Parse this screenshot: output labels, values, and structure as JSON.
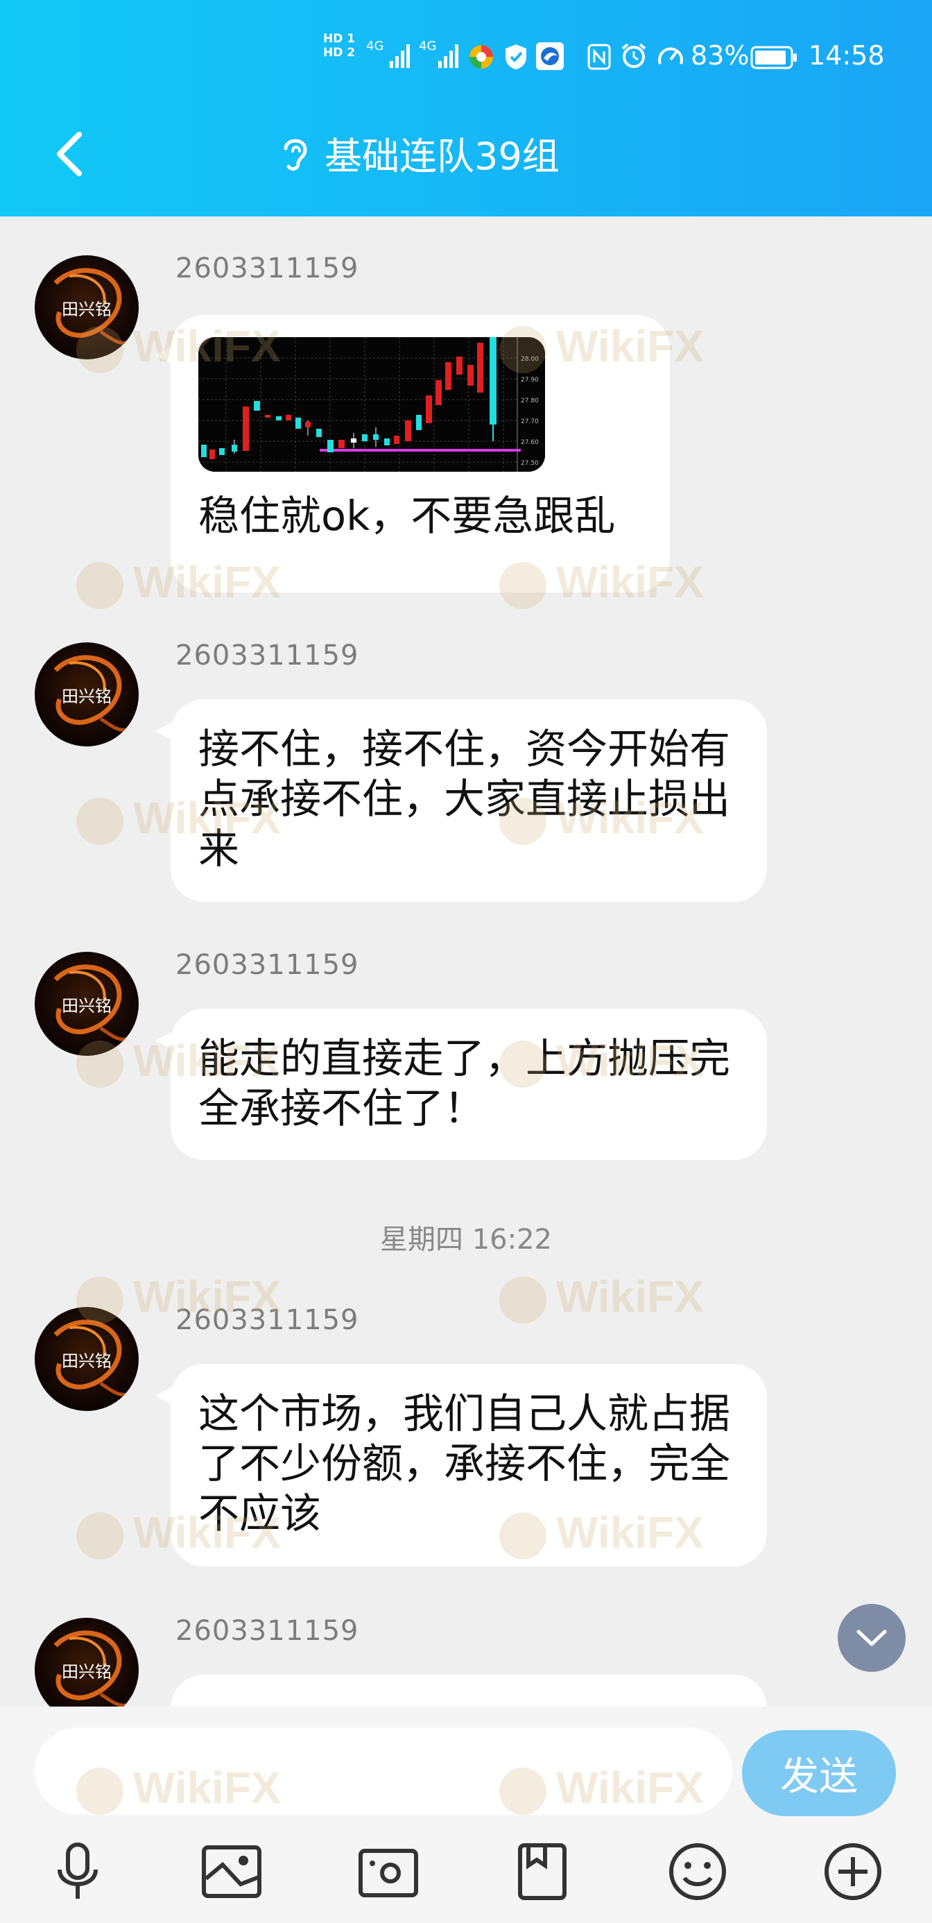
{
  "status_bar": {
    "sim1": "HD 1",
    "sim2": "HD 2",
    "signal1": "4G",
    "signal2": "4G",
    "battery": "83%",
    "time": "14:58"
  },
  "header": {
    "title": "基础连队39组",
    "back_icon": "chevron-left-icon",
    "mode_icon": "ear-icon"
  },
  "messages": [
    {
      "sender": "2603311159",
      "has_image": true,
      "text": "稳住就ok，不要急跟乱"
    },
    {
      "sender": "2603311159",
      "text": "接不住，接不住，资今开始有点承接不住，大家直接止损出来"
    },
    {
      "sender": "2603311159",
      "text": "能走的直接走了，上方抛压完全承接不住了！"
    },
    {
      "sender": "2603311159",
      "text": "这个市场，我们自己人就占据了不少份额，承接不住，完全不应该"
    },
    {
      "sender": "2603311159",
      "text": ""
    }
  ],
  "time_separator": "星期四 16:22",
  "avatar_text": "田兴铭",
  "chart_image": {
    "price_labels": [
      "28.00",
      "27.90",
      "27.80",
      "27.70",
      "27.60",
      "27.50"
    ]
  },
  "input": {
    "value": "",
    "placeholder": ""
  },
  "send_button": "发送",
  "toolbar": [
    "microphone-icon",
    "image-icon",
    "camera-icon",
    "file-icon",
    "emoji-icon",
    "plus-circle-icon"
  ],
  "watermark": "WikiFX",
  "colors": {
    "header_start": "#12c8f6",
    "header_end": "#1aa5f5",
    "send_button": "#7fcaf3",
    "candle_up": "#e02020",
    "candle_down": "#22dde0",
    "support_line": "#d63fe0"
  }
}
